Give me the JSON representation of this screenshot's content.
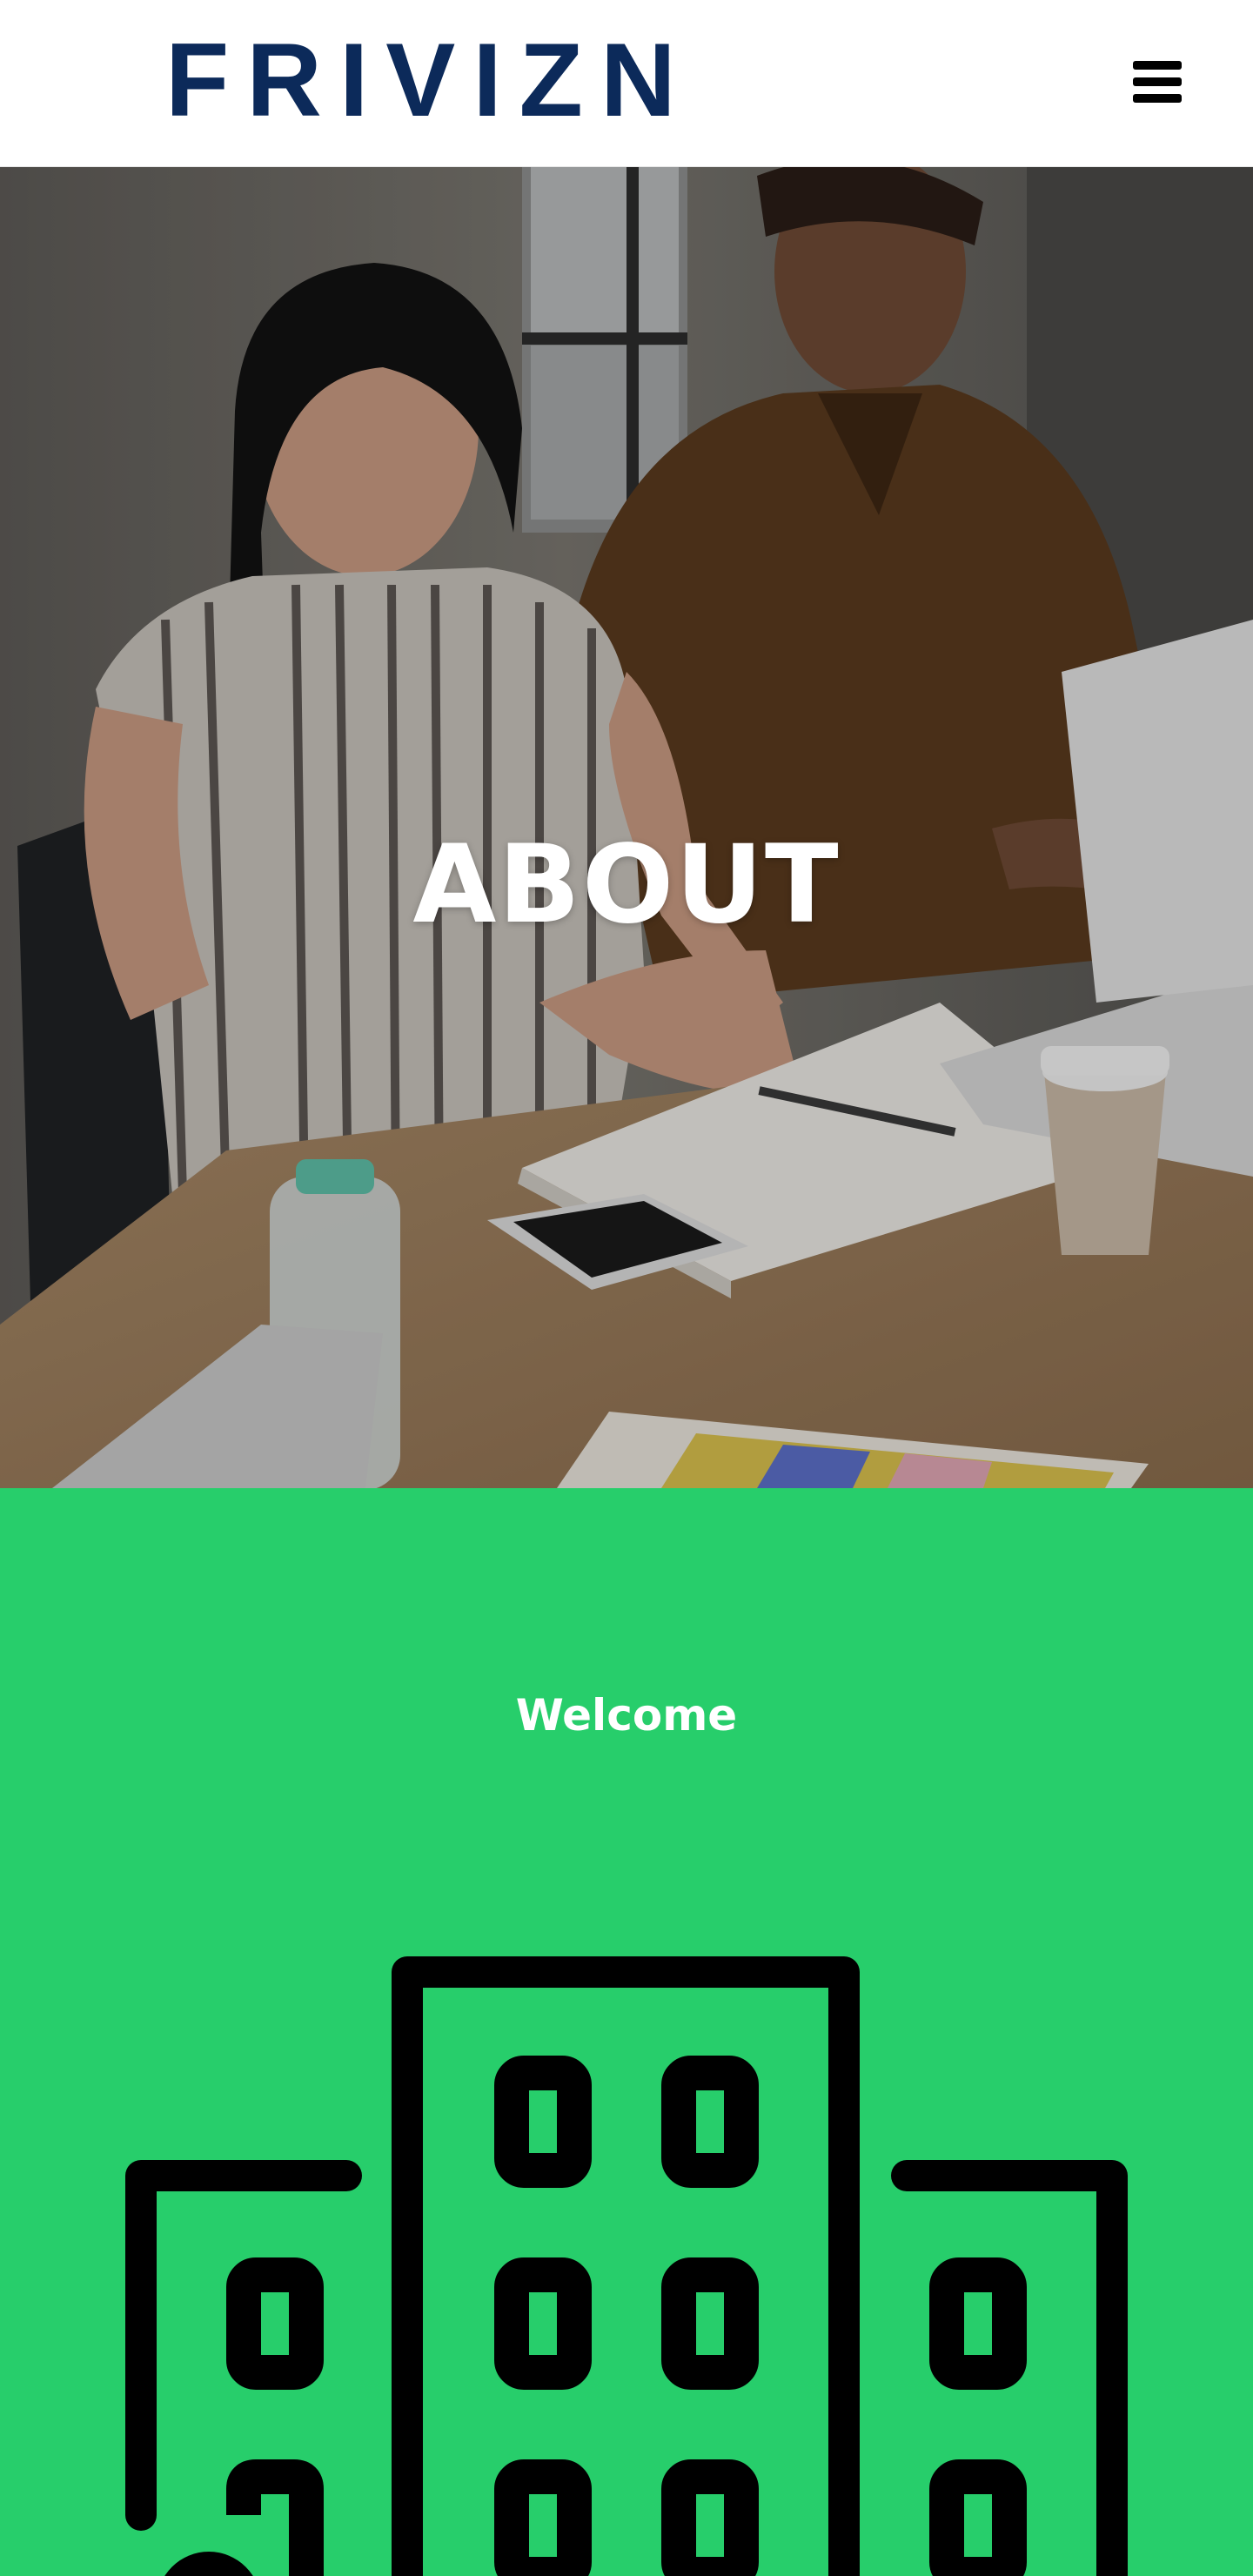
{
  "header": {
    "logo_text": "FRIVIZN",
    "menu_icon": "hamburger-menu-icon"
  },
  "hero": {
    "title": "ABOUT",
    "image": "office-meeting-photo"
  },
  "intro": {
    "heading": "Welcome",
    "icon": "buildings-icon"
  },
  "colors": {
    "brand_navy": "#0c2a5a",
    "accent_green": "#27ce6b",
    "text_white": "#ffffff",
    "icon_black": "#000000"
  }
}
